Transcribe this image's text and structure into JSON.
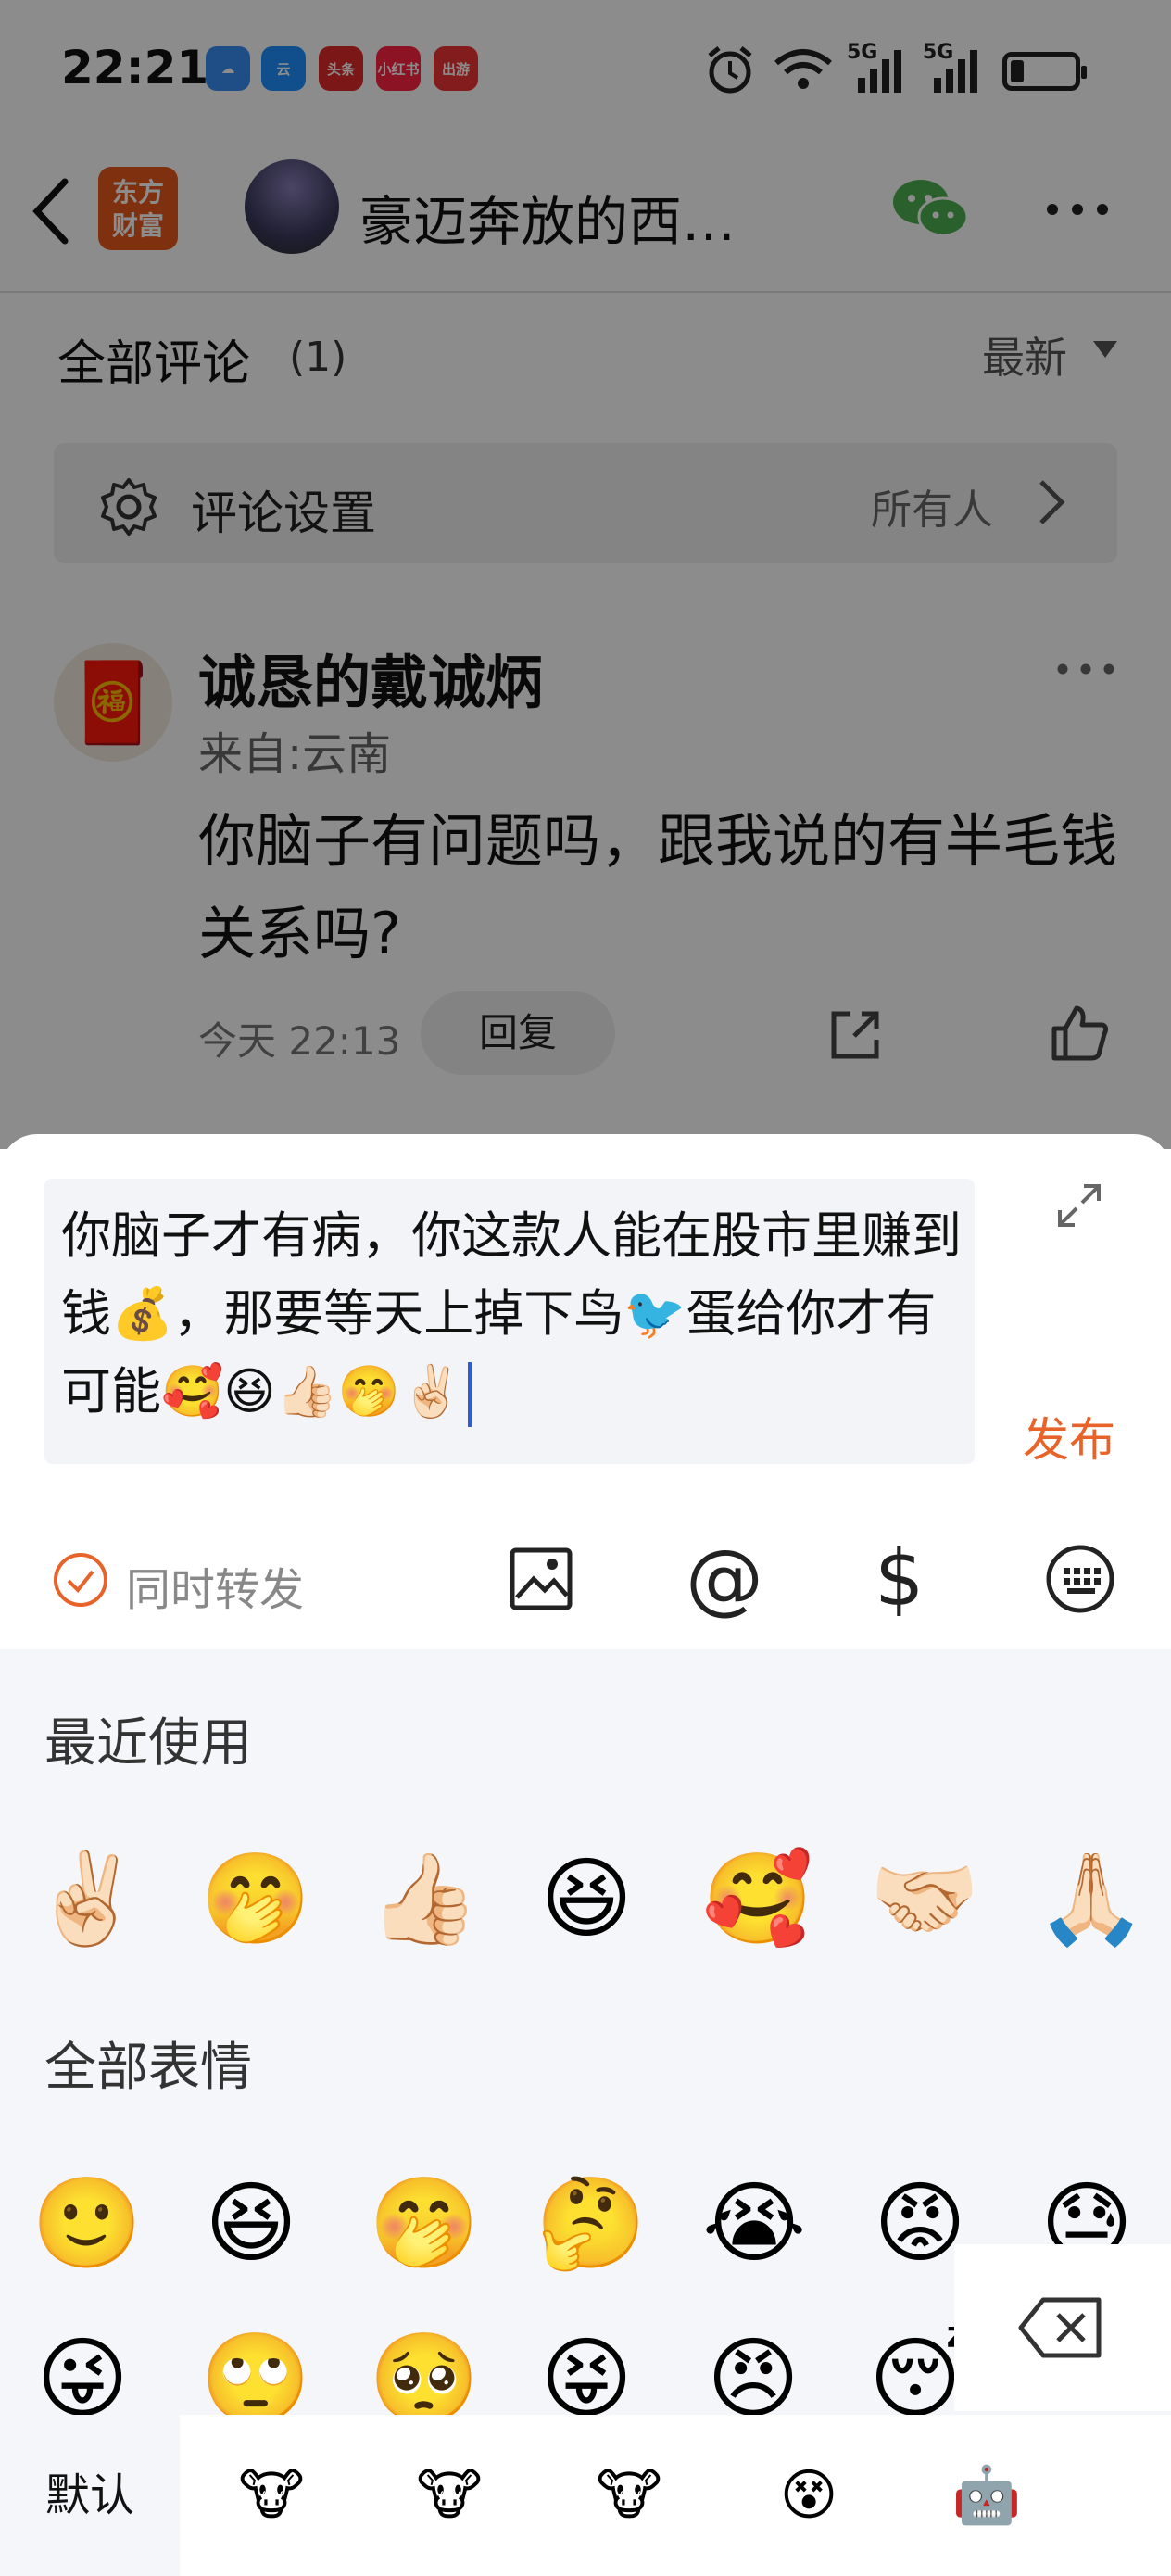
{
  "status_bar": {
    "time": "22:21",
    "apps": [
      {
        "label": "☁",
        "color": "#3a8ef6"
      },
      {
        "label": "云",
        "color": "#1e90ff"
      },
      {
        "label": "头条",
        "color": "#e22b2b"
      },
      {
        "label": "小红书",
        "color": "#ff2442"
      },
      {
        "label": "出游",
        "color": "#e33"
      }
    ],
    "network_1": "5G",
    "network_2": "5G"
  },
  "header": {
    "logo_line1": "东方",
    "logo_line2": "财富",
    "title": "豪迈奔放的西…"
  },
  "comments_section": {
    "title": "全部评论",
    "count": "(1)",
    "sort_label": "最新"
  },
  "settings": {
    "label": "评论设置",
    "value": "所有人"
  },
  "comment": {
    "author": "诚恳的戴诚炳",
    "from": "来自:云南",
    "text": "你脑子有问题吗，跟我说的有半毛钱关系吗?",
    "time": "今天 22:13",
    "reply_label": "回复"
  },
  "composer": {
    "text": "你脑子才有病，你这款人能在股市里赚到钱💰，那要等天上掉下鸟🐦蛋给你才有可能🥰😆👍🏻🤭✌🏻",
    "publish_label": "发布",
    "forward_label": "同时转发"
  },
  "emoji_panel": {
    "recent_title": "最近使用",
    "recent": [
      "✌🏻",
      "🤭",
      "👍🏻",
      "😆",
      "🥰",
      "🤝🏻",
      "🙏🏻"
    ],
    "all_title": "全部表情",
    "all_row1": [
      "🙂",
      "😆",
      "🤭",
      "🤔",
      "😭",
      "😡",
      "😓"
    ],
    "all_row2": [
      "😜",
      "🙄",
      "🥺",
      "😝",
      "😠",
      "😴"
    ],
    "tab_default": "默认",
    "sticker_tabs": [
      "🐮",
      "🐮",
      "🐮",
      "😵",
      "🤖"
    ]
  },
  "colors": {
    "accent": "#e8632a",
    "wechat": "#4caf50"
  }
}
